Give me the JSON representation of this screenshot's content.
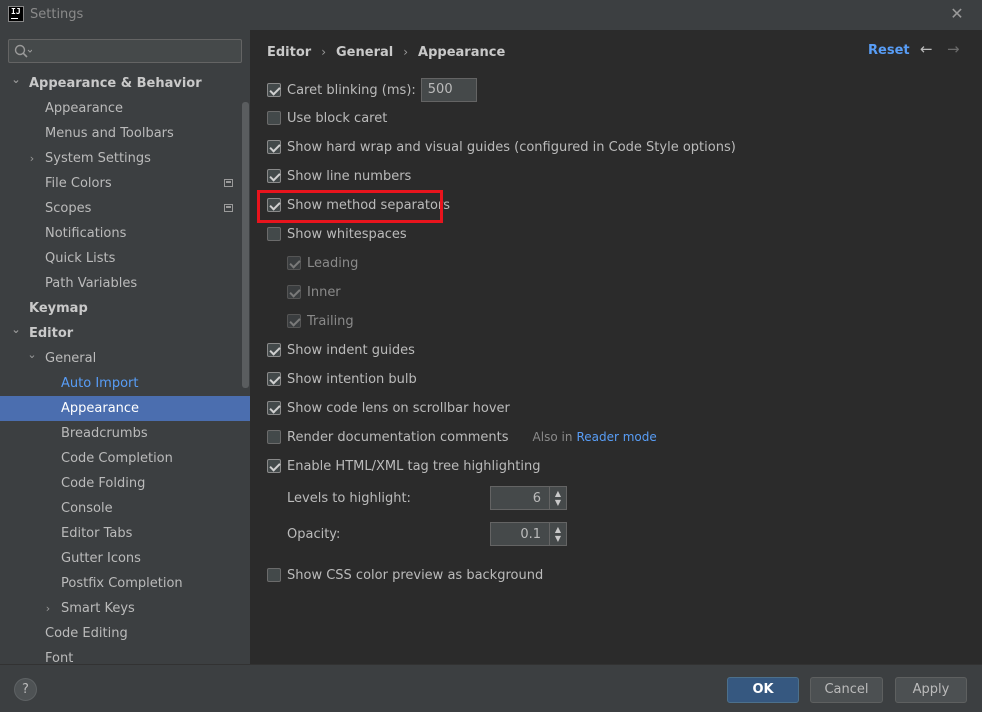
{
  "window": {
    "title": "Settings",
    "app_logo_text": "IJ",
    "close_glyph": "✕"
  },
  "search": {
    "placeholder": ""
  },
  "sidebar": {
    "items": [
      {
        "label": "Appearance & Behavior",
        "level": 0,
        "arrow": "⌄",
        "bold": true
      },
      {
        "label": "Appearance",
        "level": 1
      },
      {
        "label": "Menus and Toolbars",
        "level": 1
      },
      {
        "label": "System Settings",
        "level": 1,
        "arrow": "›"
      },
      {
        "label": "File Colors",
        "level": 1,
        "project_icon": true
      },
      {
        "label": "Scopes",
        "level": 1,
        "project_icon": true
      },
      {
        "label": "Notifications",
        "level": 1
      },
      {
        "label": "Quick Lists",
        "level": 1
      },
      {
        "label": "Path Variables",
        "level": 1
      },
      {
        "label": "Keymap",
        "level": 0,
        "bold": true
      },
      {
        "label": "Editor",
        "level": 0,
        "arrow": "⌄",
        "bold": true
      },
      {
        "label": "General",
        "level": 1,
        "arrow": "⌄"
      },
      {
        "label": "Auto Import",
        "level": 2,
        "link": true
      },
      {
        "label": "Appearance",
        "level": 2,
        "selected": true
      },
      {
        "label": "Breadcrumbs",
        "level": 2
      },
      {
        "label": "Code Completion",
        "level": 2
      },
      {
        "label": "Code Folding",
        "level": 2
      },
      {
        "label": "Console",
        "level": 2
      },
      {
        "label": "Editor Tabs",
        "level": 2
      },
      {
        "label": "Gutter Icons",
        "level": 2
      },
      {
        "label": "Postfix Completion",
        "level": 2
      },
      {
        "label": "Smart Keys",
        "level": 2,
        "arrow": "›"
      },
      {
        "label": "Code Editing",
        "level": 1
      },
      {
        "label": "Font",
        "level": 1
      }
    ]
  },
  "header": {
    "breadcrumb": [
      "Editor",
      "General",
      "Appearance"
    ],
    "separator": "›",
    "reset_label": "Reset",
    "back_glyph": "←",
    "forward_glyph": "→"
  },
  "options": {
    "caret_blinking": {
      "label": "Caret blinking (ms):",
      "checked": true,
      "value": "500"
    },
    "block_caret": {
      "label": "Use block caret",
      "checked": false
    },
    "hard_wrap": {
      "label": "Show hard wrap and visual guides (configured in Code Style options)",
      "checked": true
    },
    "line_numbers": {
      "label": "Show line numbers",
      "checked": true
    },
    "method_separators": {
      "label": "Show method separators",
      "checked": true
    },
    "whitespaces": {
      "label": "Show whitespaces",
      "checked": false
    },
    "leading": {
      "label": "Leading",
      "checked": true,
      "disabled": true
    },
    "inner": {
      "label": "Inner",
      "checked": true,
      "disabled": true
    },
    "trailing": {
      "label": "Trailing",
      "checked": true,
      "disabled": true
    },
    "indent_guides": {
      "label": "Show indent guides",
      "checked": true
    },
    "intention_bulb": {
      "label": "Show intention bulb",
      "checked": true
    },
    "code_lens": {
      "label": "Show code lens on scrollbar hover",
      "checked": true
    },
    "render_docs": {
      "label": "Render documentation comments",
      "checked": false,
      "also_in": "Also in",
      "reader_mode": "Reader mode"
    },
    "tag_tree": {
      "label": "Enable HTML/XML tag tree highlighting",
      "checked": true
    },
    "levels": {
      "label": "Levels to highlight:",
      "value": "6"
    },
    "opacity": {
      "label": "Opacity:",
      "value": "0.1"
    },
    "css_preview": {
      "label": "Show CSS color preview as background",
      "checked": false
    }
  },
  "footer": {
    "help_label": "?",
    "ok_label": "OK",
    "cancel_label": "Cancel",
    "apply_label": "Apply"
  },
  "colors": {
    "background": "#3c3f41",
    "content_background": "#2b2b2b",
    "selection": "#4b6eaf",
    "link": "#589df6",
    "highlight_annotation": "#e8141d",
    "ok_button": "#365880"
  },
  "icons": {
    "search": "search-icon",
    "up_down": "▲▼"
  }
}
